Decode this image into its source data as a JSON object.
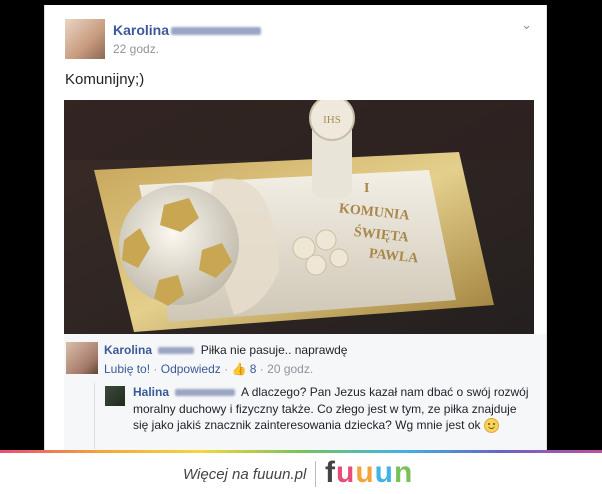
{
  "post": {
    "author": "Karolina",
    "time": "22 godz.",
    "text": "Komunijny;)",
    "menu_icon": "chevron-down-icon"
  },
  "photo": {
    "cake_text_1": "I",
    "cake_text_2": "KOMUNIA",
    "cake_text_3": "ŚWIĘTA",
    "cake_text_4": "PAWLA",
    "host_text": "IHS"
  },
  "comment1": {
    "author": "Karolina",
    "text": "Piłka nie pasuje.. naprawdę",
    "like_label": "Lubię to!",
    "separator": "·",
    "reply_label": "Odpowiedz",
    "like_count": "8",
    "time": "20 godz."
  },
  "comment2": {
    "author": "Halina",
    "text": "A dlaczego? Pan Jezus kazał nam dbać o swój rozwój moralny duchowy i fizyczny także. Co złego jest w tym, ze piłka znajduje się jako jakiś znacznik zainteresowania dziecka? Wg mnie jest ok"
  },
  "footer": {
    "text": "Więcej na fuuun.pl",
    "logo": [
      "f",
      "u",
      "u",
      "u",
      "n"
    ]
  }
}
